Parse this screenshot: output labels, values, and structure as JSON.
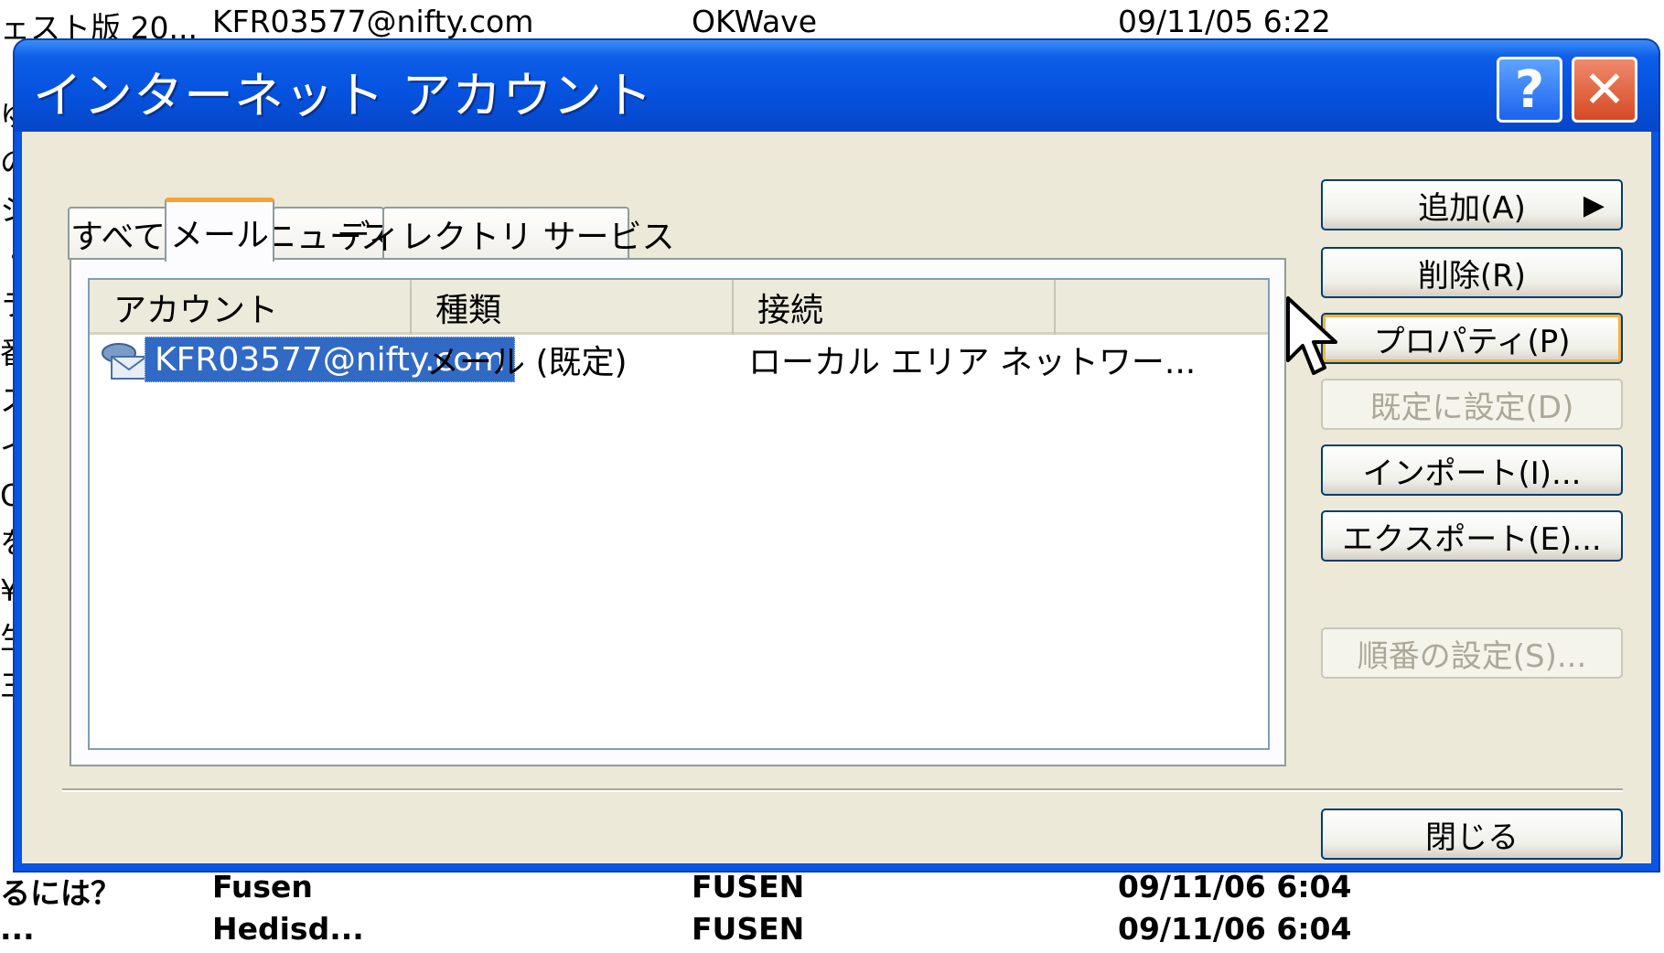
{
  "background_list": {
    "top_row": [
      "ェスト版 20...",
      "KFR03577@nifty.com",
      "OKWave",
      "09/11/05 6:22"
    ],
    "bottom_row": [
      "るには？",
      "Fusen",
      "FUSEN",
      "09/11/06 6:04"
    ],
    "bottom_row2": [
      "...",
      "Hedisd...",
      "FUSEN",
      "09/11/06 6:04"
    ],
    "left_column_chars": [
      "ゆ",
      "の",
      "シ",
      "・",
      "ラ",
      "番",
      "ス",
      "イ",
      "O",
      "を",
      "¥",
      "生",
      "三"
    ]
  },
  "window": {
    "title": "インターネット アカウント",
    "help_label": "?",
    "close_label": "✕"
  },
  "tabs": [
    {
      "label": "すべて",
      "active": false
    },
    {
      "label": "メール",
      "active": true
    },
    {
      "label": "ニュース",
      "active": false
    },
    {
      "label": "ディレクトリ サービス",
      "active": false
    }
  ],
  "list": {
    "columns": [
      "アカウント",
      "種類",
      "接続"
    ],
    "rows": [
      {
        "account": "KFR03577@nifty.com",
        "type": "メール (既定)",
        "connection": "ローカル エリア ネットワー..."
      }
    ]
  },
  "buttons": {
    "add": "追加(A)",
    "add_arrow": "▶",
    "remove": "削除(R)",
    "properties": "プロパティ(P)",
    "set_default": "既定に設定(D)",
    "import": "インポート(I)...",
    "export": "エクスポート(E)...",
    "set_order": "順番の設定(S)...",
    "close": "閉じる"
  },
  "colors": {
    "titlebar": "#0553e0",
    "client": "#ece9d8",
    "selection": "#316ac5",
    "focus_ring": "#f8b33e"
  },
  "icons": {
    "account": "mail-account-icon",
    "cursor": "mouse-pointer-icon"
  }
}
